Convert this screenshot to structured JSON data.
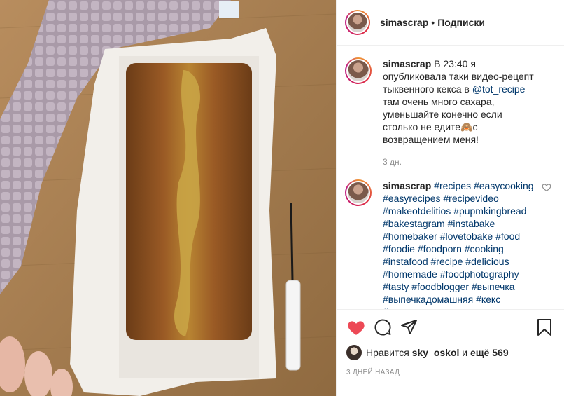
{
  "header": {
    "username": "simascrap",
    "separator": "•",
    "follow_label": "Подписки"
  },
  "caption": {
    "username": "simascrap",
    "text_before_mention": "В 23:40 я опубликовала таки видео-рецепт тыквенного кекса в ",
    "mention": "@tot_recipe",
    "text_after_mention": " ⁣⁣там очень много сахара, уменьшайте конечно если столько не едите🙈с возвращением меня!",
    "time": "3 дн."
  },
  "tags_comment": {
    "username": "simascrap",
    "hashtags": "#recipes #easycooking #easyrecipes #recipevideo #makeotdelitios #pupmkingbread #bakestagram #instabake #homebaker #lovetobake #food #foodie #foodporn #cooking #instafood #recipe #delicious #homemade #foodphotography #tasty #foodblogger #выпечка #выпечкадомашняя #кекс #выпечкатанята"
  },
  "likes": {
    "prefix": "Нравится",
    "user": "sky_oskol",
    "conj": "и",
    "count_text": "ещё 569"
  },
  "posted_ago": "3 ДНЕЙ НАЗАД",
  "icons": [
    "heart-icon-filled",
    "comment-icon",
    "share-icon",
    "bookmark-icon",
    "heart-outline-icon"
  ],
  "colors": {
    "like_red": "#ed4956",
    "hashtag_blue": "#00376b",
    "muted_gray": "#8e8e8e"
  }
}
